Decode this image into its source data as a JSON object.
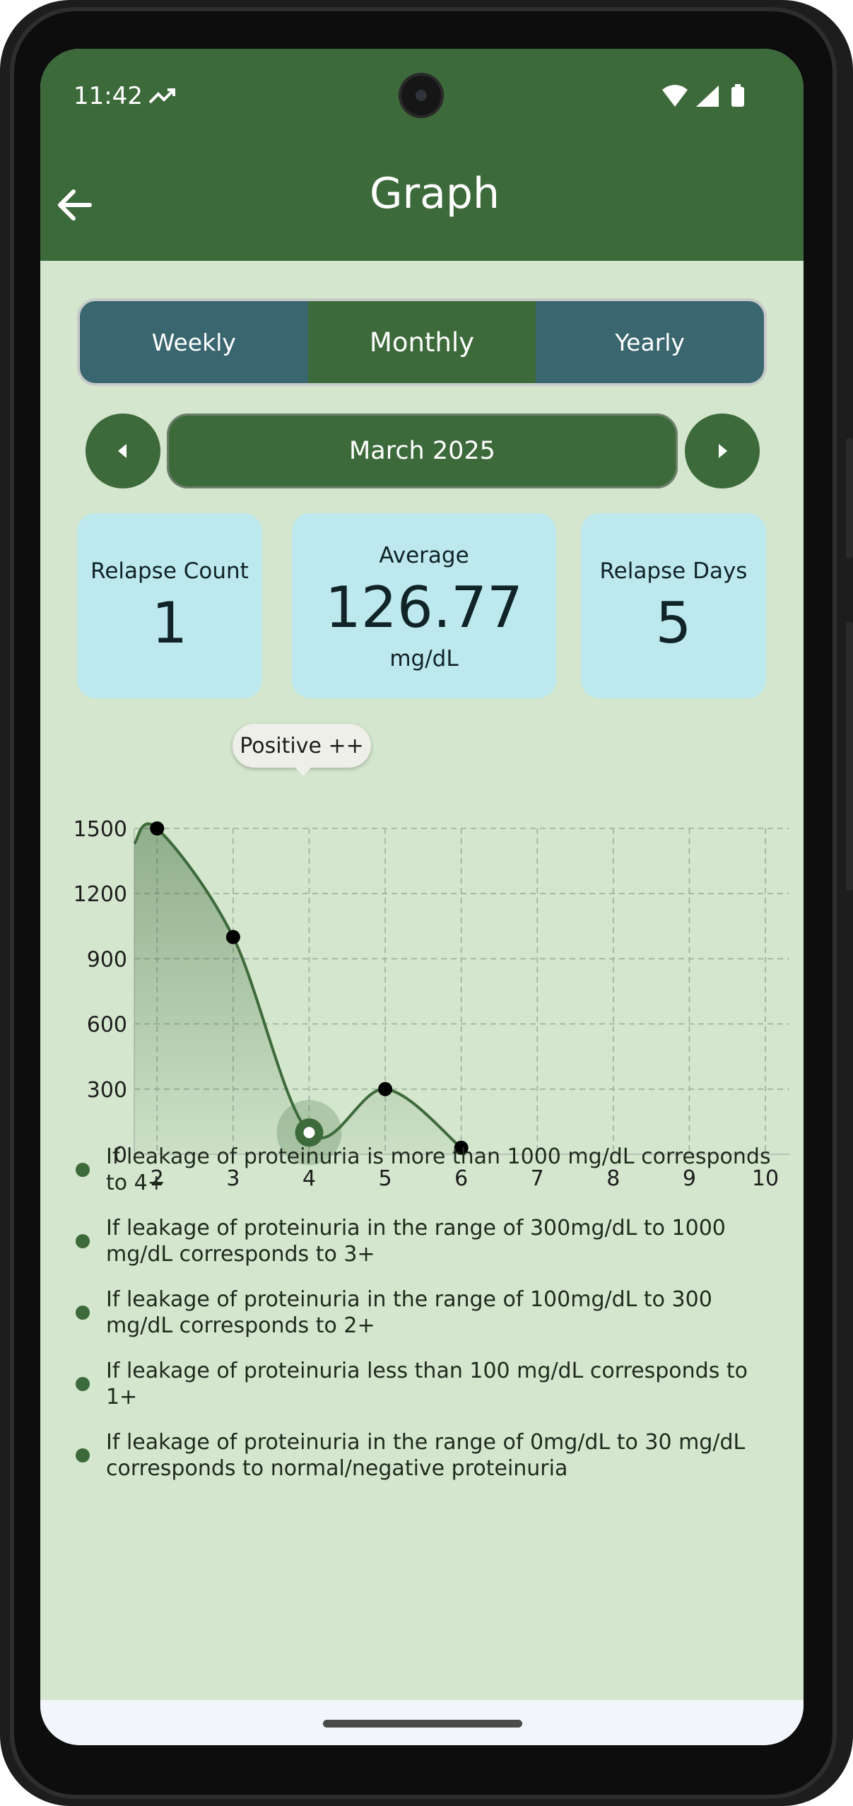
{
  "status_bar": {
    "time": "11:42"
  },
  "header": {
    "title": "Graph"
  },
  "tabs": [
    {
      "label": "Weekly",
      "active": false
    },
    {
      "label": "Monthly",
      "active": true
    },
    {
      "label": "Yearly",
      "active": false
    }
  ],
  "period": {
    "label": "March 2025"
  },
  "stats": {
    "relapse_count": {
      "label": "Relapse Count",
      "value": "1"
    },
    "average": {
      "label": "Average",
      "value": "126.77",
      "unit": "mg/dL"
    },
    "relapse_days": {
      "label": "Relapse Days",
      "value": "5"
    }
  },
  "tooltip": {
    "text": "Positive ++"
  },
  "chart_data": {
    "type": "line",
    "x": [
      2,
      3,
      4,
      5,
      6
    ],
    "y": [
      1500,
      1000,
      100,
      300,
      30
    ],
    "x_ticks": [
      "2",
      "3",
      "4",
      "5",
      "6",
      "7",
      "8",
      "9",
      "10"
    ],
    "y_ticks": [
      "0",
      "300",
      "600",
      "900",
      "1200",
      "1500"
    ],
    "xlim": [
      1.7,
      10
    ],
    "ylim": [
      0,
      1500
    ],
    "grid": true,
    "selected_x": 4,
    "colors": {
      "line": "#3d6a3b",
      "point": "#000000"
    }
  },
  "legend": [
    "If leakage of proteinuria is more than 1000 mg/dL corresponds to 4+",
    "If leakage of proteinuria in the range of 300mg/dL to 1000 mg/dL corresponds to 3+",
    "If leakage of proteinuria in the range of 100mg/dL to 300 mg/dL corresponds to 2+",
    "If leakage of proteinuria less than 100 mg/dL corresponds to 1+",
    "If leakage of proteinuria in the range of 0mg/dL to 30 mg/dL corresponds to normal/negative proteinuria"
  ]
}
